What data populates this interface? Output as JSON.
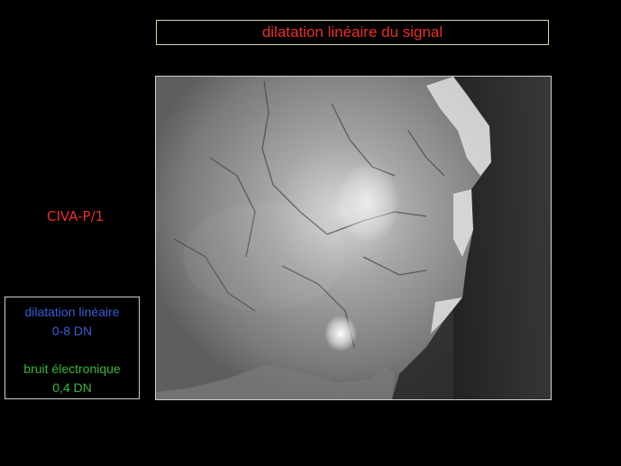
{
  "header": {
    "title": "dilatation linéaire du signal"
  },
  "instrument": {
    "label": "CIVA-P/1"
  },
  "info": {
    "stretch_label": "dilatation linéaire",
    "stretch_range": "0-8 DN",
    "noise_label": "bruit électronique",
    "noise_value": "0,4 DN"
  },
  "colors": {
    "title": "#e8302a",
    "instrument": "#e8302a",
    "stretch": "#3b5cd6",
    "noise": "#38b838"
  }
}
